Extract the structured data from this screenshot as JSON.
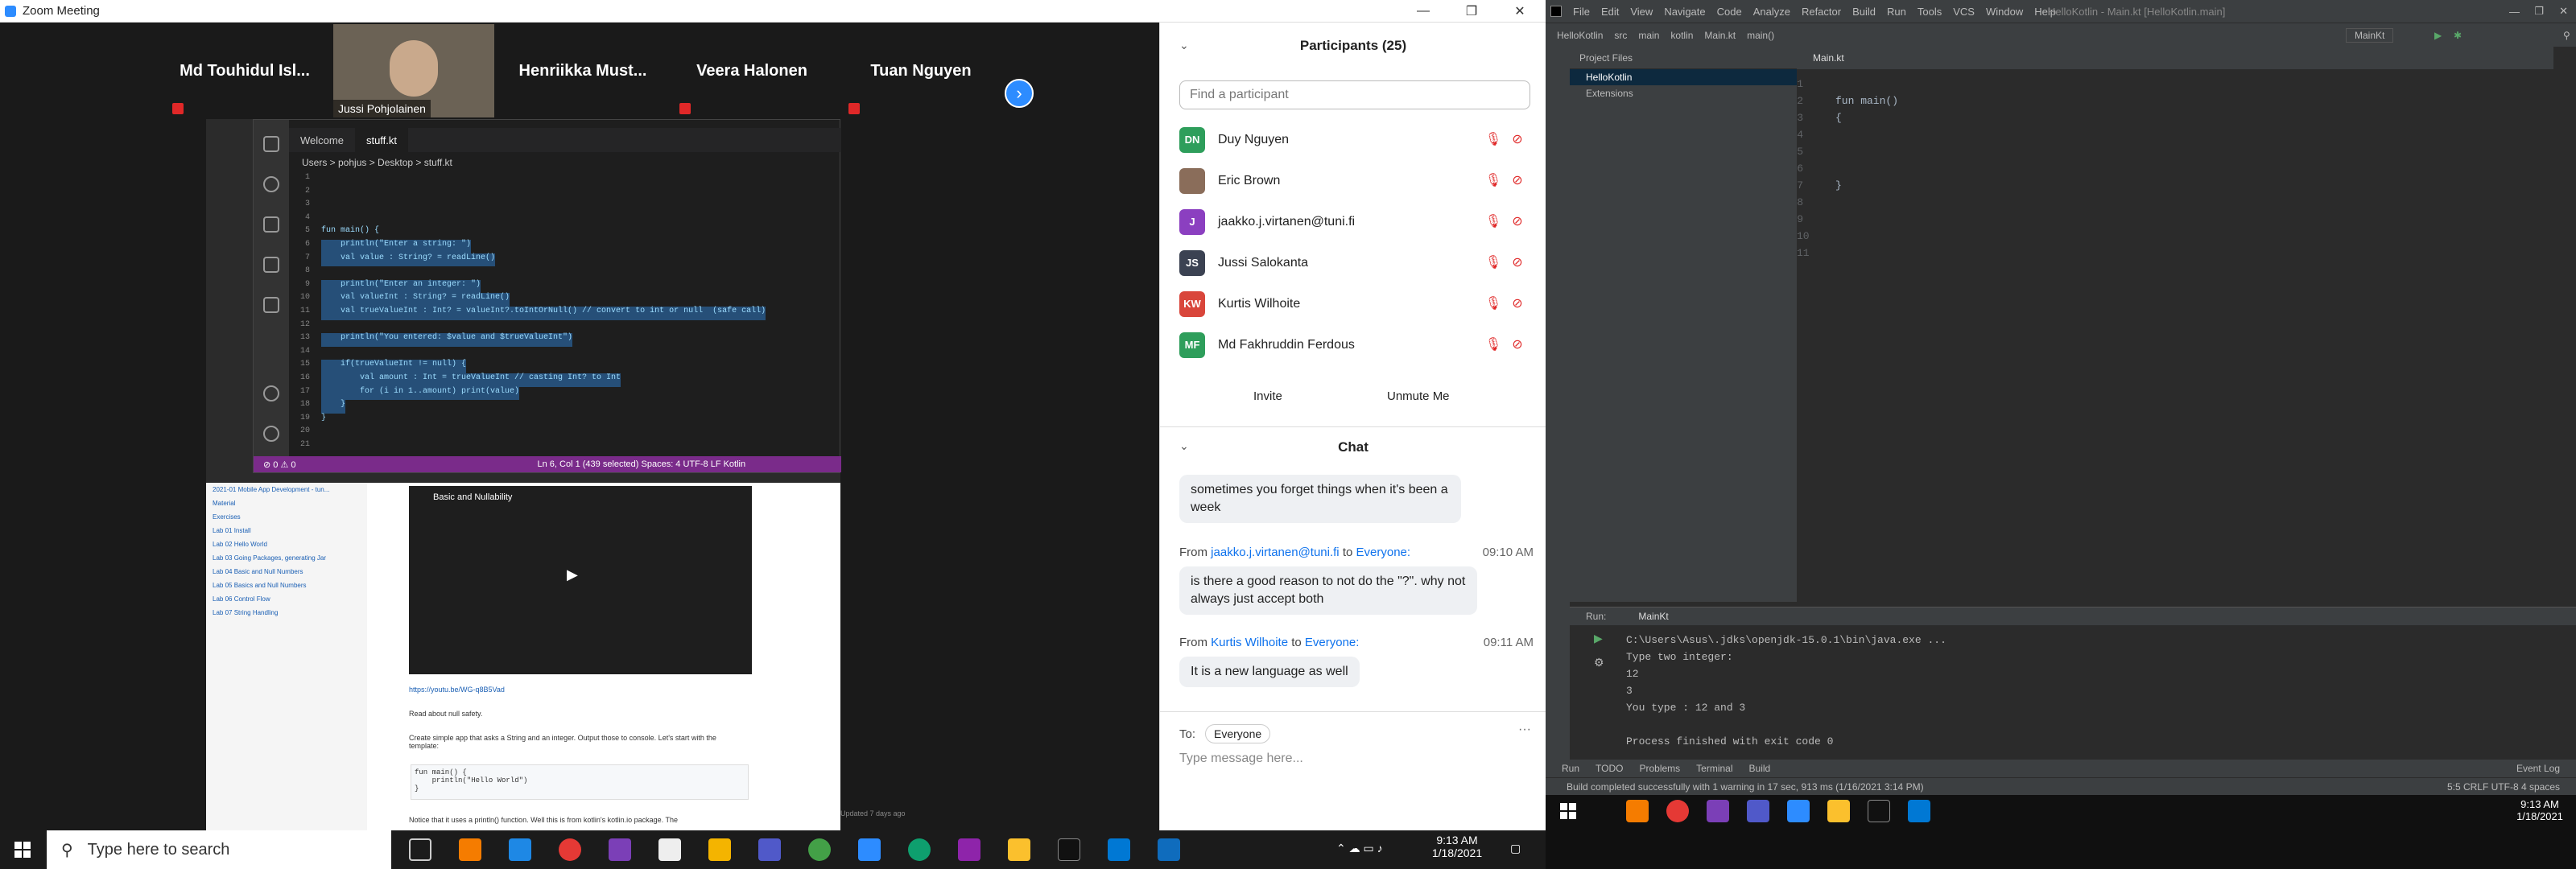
{
  "zoom": {
    "title": "Zoom Meeting",
    "gallery": [
      "Md  Touhidul  Isl...",
      "Jussi Pohjolainen",
      "Henriikka  Must...",
      "Veera Halonen",
      "Tuan Nguyen"
    ],
    "vscode": {
      "tabs": [
        "Welcome",
        "stuff.kt"
      ],
      "breadcrumb": "Users  >  pohjus  >  Desktop  >  stuff.kt",
      "code": [
        {
          "n": "1",
          "t": "",
          "sel": false
        },
        {
          "n": "2",
          "t": "",
          "sel": false
        },
        {
          "n": "3",
          "t": "",
          "sel": false
        },
        {
          "n": "4",
          "t": "",
          "sel": false
        },
        {
          "n": "5",
          "t": "fun main() {",
          "sel": false
        },
        {
          "n": "6",
          "t": "    println(\"Enter a string: \")",
          "sel": true
        },
        {
          "n": "7",
          "t": "    val value : String? = readLine()",
          "sel": true
        },
        {
          "n": "8",
          "t": "",
          "sel": true
        },
        {
          "n": "9",
          "t": "    println(\"Enter an integer: \")",
          "sel": true
        },
        {
          "n": "10",
          "t": "    val valueInt : String? = readLine()",
          "sel": true
        },
        {
          "n": "11",
          "t": "    val trueValueInt : Int? = valueInt?.toIntOrNull() // convert to int or null  (safe call)",
          "sel": true
        },
        {
          "n": "12",
          "t": "",
          "sel": true
        },
        {
          "n": "13",
          "t": "    println(\"You entered: $value and $trueValueInt\")",
          "sel": true
        },
        {
          "n": "14",
          "t": "",
          "sel": true
        },
        {
          "n": "15",
          "t": "    if(trueValueInt != null) {",
          "sel": true
        },
        {
          "n": "16",
          "t": "        val amount : Int = trueValueInt // casting Int? to Int",
          "sel": true
        },
        {
          "n": "17",
          "t": "        for (i in 1..amount) print(value)",
          "sel": true
        },
        {
          "n": "18",
          "t": "    }",
          "sel": true
        },
        {
          "n": "19",
          "t": "}",
          "sel": false
        },
        {
          "n": "20",
          "t": "",
          "sel": false
        },
        {
          "n": "21",
          "t": "",
          "sel": false
        }
      ],
      "status_left": "⊘ 0 ⚠ 0",
      "status_right": "Ln 6, Col 1 (439 selected)    Spaces: 4    UTF-8    LF    Kotlin"
    },
    "browser": {
      "sidebar": [
        "2021-01 Mobile App Development - tun...",
        "Material",
        "Exercises",
        "Lab 01 Install",
        "Lab 02 Hello World",
        "Lab 03 Going Packages, generating Jar",
        "Lab 04 Basic and Null Numbers",
        "Lab 05 Basics and Null Numbers",
        "Lab 06 Control Flow",
        "Lab 07 String Handling"
      ],
      "video_title": "Basic and Nullability",
      "link": "https://youtu.be/WG-q8B5Vad",
      "read_about": "Read about null safety.",
      "para": "Create simple app that asks a String and an integer. Output those to console. Let's start with the template:",
      "code": "fun main() {\n    println(\"Hello World\")\n}",
      "notice": "Notice that it uses a println() function. Well this is from kotlin's kotlin.io package. The",
      "updated": "Updated 7 days ago"
    },
    "participants": {
      "header": "Participants (25)",
      "search_placeholder": "Find a participant",
      "list": [
        {
          "initials": "DN",
          "name": "Duy Nguyen",
          "color": "#2e9e5b"
        },
        {
          "initials": "",
          "name": "Eric Brown",
          "color": "#8a6d5a"
        },
        {
          "initials": "J",
          "name": "jaakko.j.virtanen@tuni.fi",
          "color": "#8b3fc0"
        },
        {
          "initials": "JS",
          "name": "Jussi Salokanta",
          "color": "#3b4252"
        },
        {
          "initials": "KW",
          "name": "Kurtis Wilhoite",
          "color": "#d9463b"
        },
        {
          "initials": "MF",
          "name": "Md Fakhruddin Ferdous",
          "color": "#2e9e5b"
        }
      ],
      "invite": "Invite",
      "unmute": "Unmute Me"
    },
    "chat": {
      "header": "Chat",
      "messages": [
        {
          "text": "sometimes you forget things when it's been a week"
        },
        {
          "from_label": "From",
          "who": "jaakko.j.virtanen@tuni.fi",
          "to_label": "to",
          "to": "Everyone:",
          "time": "09:10 AM",
          "text": "is there a good reason to not do the \"?\". why not always just accept both"
        },
        {
          "from_label": "From",
          "who": "Kurtis Wilhoite",
          "to_label": "to",
          "to": "Everyone:",
          "time": "09:11 AM",
          "text": "It is a new language as well"
        }
      ],
      "to_label": "To:",
      "to_value": "Everyone",
      "input_placeholder": "Type message here..."
    },
    "taskbar": {
      "search": "Type here to search",
      "time": "9:13 AM",
      "date": "1/18/2021"
    }
  },
  "intellij": {
    "menu": [
      "File",
      "Edit",
      "View",
      "Navigate",
      "Code",
      "Analyze",
      "Refactor",
      "Build",
      "Run",
      "Tools",
      "VCS",
      "Window",
      "Help"
    ],
    "title": "HelloKotlin - Main.kt [HelloKotlin.main]",
    "crumbs": [
      "HelloKotlin",
      "src",
      "main",
      "kotlin",
      "Main.kt",
      "main()"
    ],
    "run_config": "MainKt",
    "project_header": "Project Files",
    "project_items": [
      "HelloKotlin",
      "Extensions"
    ],
    "editor_tab": "Main.kt",
    "code": [
      {
        "n": "1",
        "t": ""
      },
      {
        "n": "2",
        "t": "fun main()"
      },
      {
        "n": "3",
        "t": "{"
      },
      {
        "n": "4",
        "t": ""
      },
      {
        "n": "5",
        "t": ""
      },
      {
        "n": "6",
        "t": ""
      },
      {
        "n": "7",
        "t": "}"
      },
      {
        "n": "8",
        "t": ""
      },
      {
        "n": "9",
        "t": ""
      },
      {
        "n": "10",
        "t": ""
      },
      {
        "n": "11",
        "t": ""
      }
    ],
    "run_header": "Run:",
    "run_tab": "MainKt",
    "output": [
      "C:\\Users\\Asus\\.jdks\\openjdk-15.0.1\\bin\\java.exe ...",
      "Type two integer:",
      "12",
      "3",
      "You type : 12 and 3",
      "",
      "Process finished with exit code 0"
    ],
    "bottom_tabs": [
      "Run",
      "TODO",
      "Problems",
      "Terminal",
      "Build"
    ],
    "event_log": "Event Log",
    "status": "Build completed successfully with 1 warning in 17 sec, 913 ms (1/16/2021 3:14 PM)",
    "status_right": "5:5   CRLF   UTF-8   4 spaces",
    "taskbar_time": "9:13 AM",
    "taskbar_date": "1/18/2021"
  }
}
